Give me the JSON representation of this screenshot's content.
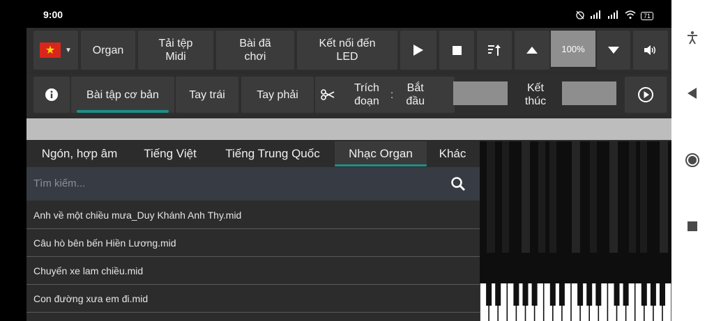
{
  "status": {
    "time": "9:00",
    "battery": "71"
  },
  "toolbar1": {
    "organ": "Organ",
    "load_midi": "Tải tệp\nMidi",
    "played": "Bài đã\nchơi",
    "connect_led": "Kết nối đến\nLED",
    "zoom": "100%"
  },
  "toolbar2": {
    "basic": "Bài tập cơ bản",
    "left": "Tay trái",
    "right": "Tay phải",
    "excerpt": "Trích\nđoạn",
    "colon": ":",
    "start": "Bắt\nđầu",
    "end": "Kết\nthúc"
  },
  "tabs": [
    {
      "label": "Ngón, hợp âm"
    },
    {
      "label": "Tiếng Việt"
    },
    {
      "label": "Tiếng Trung Quốc"
    },
    {
      "label": "Nhạc Organ"
    },
    {
      "label": "Khác"
    }
  ],
  "search": {
    "placeholder": "Tìm kiếm..."
  },
  "songs": [
    "Anh về một chiều mưa_Duy Khánh Anh Thy.mid",
    "Câu hò bên bến Hiền Lương.mid",
    "Chuyến xe lam chiều.mid",
    "Con đường xưa em đi.mid"
  ],
  "colors": {
    "accent": "#1f8f8a",
    "flag_red": "#da251d",
    "flag_star": "#ffdd00"
  }
}
